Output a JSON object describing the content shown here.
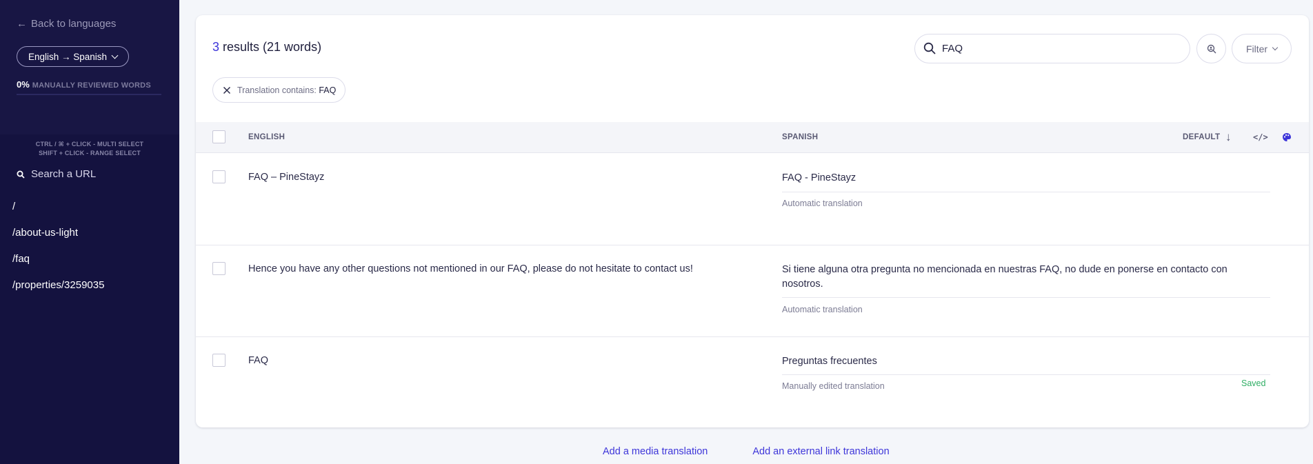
{
  "sidebar": {
    "back_label": "Back to languages",
    "language_pair": "English → Spanish",
    "review_percent": "0%",
    "review_label": "MANUALLY REVIEWED WORDS",
    "hint_multi": "CTRL / ⌘ + CLICK - MULTI SELECT",
    "hint_range": "SHIFT + CLICK - RANGE SELECT",
    "url_search_placeholder": "Search a URL",
    "urls": [
      "/",
      "/about-us-light",
      "/faq",
      "/properties/3259035"
    ]
  },
  "header": {
    "result_count": "3",
    "result_text": " results (21 words)",
    "search_value": "FAQ",
    "filter_label": "Filter",
    "chip_label": "Translation contains: ",
    "chip_value": "FAQ"
  },
  "table": {
    "col_source": "ENGLISH",
    "col_target": "SPANISH",
    "sort_label": "DEFAULT",
    "rows": [
      {
        "source": "FAQ – PineStayz",
        "target": "FAQ - PineStayz",
        "status": "Automatic translation",
        "saved": ""
      },
      {
        "source": "Hence you have any other questions not mentioned in our FAQ, please do not hesitate to contact us!",
        "target": "Si tiene alguna otra pregunta no mencionada en nuestras FAQ, no dude en ponerse en contacto con nosotros.",
        "status": "Automatic translation",
        "saved": ""
      },
      {
        "source": "FAQ",
        "target": "Preguntas frecuentes",
        "status": "Manually edited translation",
        "saved": "Saved"
      }
    ]
  },
  "footer": {
    "media_link": "Add a media translation",
    "external_link": "Add an external link translation"
  },
  "colors": {
    "accent": "#3d35d9",
    "sidebar_bg": "#14123f",
    "saved_green": "#2fae64"
  },
  "icons": [
    "arrow-left-icon",
    "chevron-down-icon",
    "search-icon",
    "search-person-icon",
    "close-icon",
    "arrow-down-icon",
    "code-icon",
    "palette-icon"
  ]
}
